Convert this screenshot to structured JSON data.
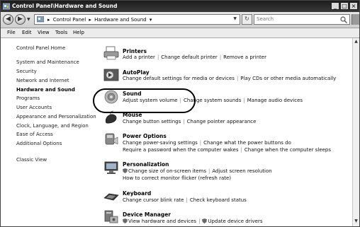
{
  "window": {
    "title": "Control Panel\\Hardware and Sound",
    "min_label": "_",
    "max_label": "□",
    "close_label": "×"
  },
  "nav": {
    "back_glyph": "◀",
    "forward_glyph": "▶",
    "breadcrumb": [
      "Control Panel",
      "Hardware and Sound"
    ],
    "search_placeholder": "Search"
  },
  "menu": [
    "File",
    "Edit",
    "View",
    "Tools",
    "Help"
  ],
  "sidebar": {
    "items": [
      {
        "label": "Control Panel Home"
      },
      {
        "label": "System and Maintenance"
      },
      {
        "label": "Security"
      },
      {
        "label": "Network and Internet"
      },
      {
        "label": "Hardware and Sound",
        "current": true
      },
      {
        "label": "Programs"
      },
      {
        "label": "User Accounts"
      },
      {
        "label": "Appearance and Personalization"
      },
      {
        "label": "Clock, Language, and Region"
      },
      {
        "label": "Ease of Access"
      },
      {
        "label": "Additional Options"
      },
      {
        "label": "Classic View"
      }
    ]
  },
  "categories": {
    "printers": {
      "title": "Printers",
      "links": [
        "Add a printer",
        "Change default printer",
        "Remove a printer"
      ]
    },
    "autoplay": {
      "title": "AutoPlay",
      "links": [
        "Change default settings for media or devices",
        "Play CDs or other media automatically"
      ]
    },
    "sound": {
      "title": "Sound",
      "links": [
        "Adjust system volume",
        "Change system sounds",
        "Manage audio devices"
      ]
    },
    "mouse": {
      "title": "Mouse",
      "links": [
        "Change button settings",
        "Change pointer appearance"
      ]
    },
    "power": {
      "title": "Power Options",
      "links": [
        "Change power-saving settings",
        "Change what the power buttons do",
        "Require a password when the computer wakes",
        "Change when the computer sleeps"
      ]
    },
    "personalization": {
      "title": "Personalization",
      "links": [
        "Change size of on-screen items",
        "Adjust screen resolution",
        "How to correct monitor flicker (refresh rate)"
      ]
    },
    "keyboard": {
      "title": "Keyboard",
      "links": [
        "Change cursor blink rate",
        "Check keyboard status"
      ]
    },
    "device_manager": {
      "title": "Device Manager",
      "links": [
        "View hardware and devices",
        "Update device drivers"
      ]
    }
  },
  "colors": {
    "titlebar": "#1c1c1c",
    "highlight_oval": "#000000"
  }
}
